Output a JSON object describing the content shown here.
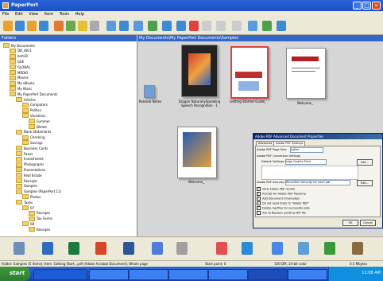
{
  "window": {
    "title": "PaperPort"
  },
  "menu": [
    "File",
    "Edit",
    "View",
    "Item",
    "Tools",
    "Help"
  ],
  "panes": {
    "folders_title": "Folders",
    "path": "My Documents\\My PaperPort Documents\\Samples"
  },
  "tree": [
    {
      "label": "My Documents",
      "indent": 0
    },
    {
      "label": "DB_4811",
      "indent": 1
    },
    {
      "label": "bmt30",
      "indent": 1
    },
    {
      "label": "GEE",
      "indent": 1
    },
    {
      "label": "GLOBAL",
      "indent": 1
    },
    {
      "label": "MEDIO",
      "indent": 1
    },
    {
      "label": "Movies",
      "indent": 1
    },
    {
      "label": "My eBooks",
      "indent": 1
    },
    {
      "label": "My Music",
      "indent": 1
    },
    {
      "label": "My PaperPort Documents",
      "indent": 1
    },
    {
      "label": "Articles",
      "indent": 2
    },
    {
      "label": "Computers",
      "indent": 3
    },
    {
      "label": "Politics",
      "indent": 3
    },
    {
      "label": "Vacations",
      "indent": 3
    },
    {
      "label": "Summer",
      "indent": 4
    },
    {
      "label": "Winter",
      "indent": 4
    },
    {
      "label": "Bank Statements",
      "indent": 2
    },
    {
      "label": "Checking",
      "indent": 3
    },
    {
      "label": "Savings",
      "indent": 3
    },
    {
      "label": "Business Cards",
      "indent": 2
    },
    {
      "label": "Faxes",
      "indent": 2
    },
    {
      "label": "Investments",
      "indent": 2
    },
    {
      "label": "Photographs",
      "indent": 2
    },
    {
      "label": "Presentations",
      "indent": 2
    },
    {
      "label": "Real Estate",
      "indent": 2
    },
    {
      "label": "Receipts",
      "indent": 2
    },
    {
      "label": "Samples",
      "indent": 2
    },
    {
      "label": "Samples (PaperPort 11)",
      "indent": 2
    },
    {
      "label": "Photos",
      "indent": 3
    },
    {
      "label": "Taxes",
      "indent": 2
    },
    {
      "label": "07",
      "indent": 3
    },
    {
      "label": "Receipts",
      "indent": 4
    },
    {
      "label": "Tax Forms",
      "indent": 4
    },
    {
      "label": "08",
      "indent": 3
    },
    {
      "label": "Receipts",
      "indent": 4
    }
  ],
  "items": [
    {
      "label": "Release Notes"
    },
    {
      "label": "Dragon NaturallySpeaking Speech Recognition - 1"
    },
    {
      "label": "Getting Started Guide_"
    },
    {
      "label": "Welcome_"
    },
    {
      "label": "Welcome_"
    }
  ],
  "dialog": {
    "title": "Adobe PDF Advanced Document Properties",
    "tabs": [
      "Advanced",
      "Adobe PDF Settings"
    ],
    "page_size_label": "Adobe PDF Page Size:",
    "page_size_value": "Letter",
    "conversion_label": "Adobe PDF Conversion Settings",
    "default_settings_label": "Default Settings:",
    "default_settings_value": "High Quality Print",
    "edit_label": "Edit...",
    "security_label": "Adobe PDF Security:",
    "security_value": "Reconfirm Security for each job",
    "checks": [
      {
        "label": "View Adobe PDF results",
        "checked": true
      },
      {
        "label": "Prompt for Adobe PDF filename",
        "checked": true
      },
      {
        "label": "Add Document Information",
        "checked": true
      },
      {
        "label": "Do not send fonts to \"Adobe PDF\"",
        "checked": true
      },
      {
        "label": "Delete log files for successful jobs",
        "checked": true
      },
      {
        "label": "Ask to Replace existing PDF file",
        "checked": false
      }
    ],
    "ok": "OK",
    "cancel": "Cancel"
  },
  "status": {
    "left": "Folder: Samples (5 items); Item: Getting Start...pdf (Adobe Acrobat Document); Whole page",
    "mid": "Start point: 0",
    "right1": "100 DPI, 24-bit color",
    "right2": "0.5 Mbytes"
  },
  "taskbar": {
    "start": "start",
    "clock": "11:08 AM"
  }
}
